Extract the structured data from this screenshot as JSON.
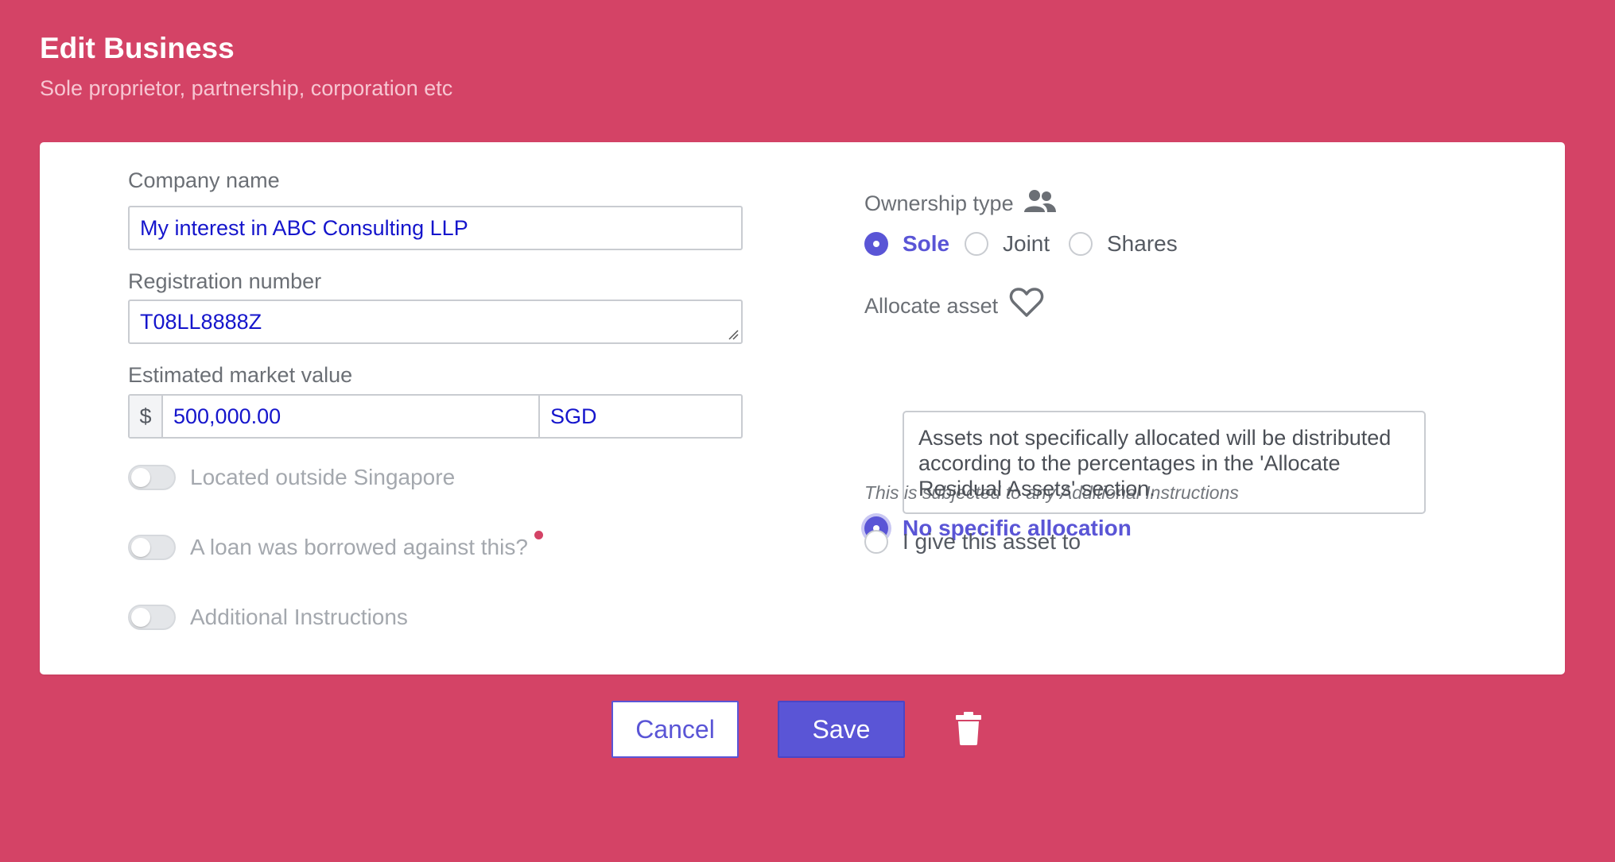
{
  "header": {
    "title": "Edit Business",
    "subtitle": "Sole proprietor, partnership, corporation etc"
  },
  "form": {
    "company_name": {
      "label": "Company name",
      "value": "My interest in ABC Consulting LLP"
    },
    "registration_number": {
      "label": "Registration number",
      "value": "T08LL8888Z"
    },
    "market_value": {
      "label": "Estimated market value",
      "prefix": "$",
      "amount": "500,000.00",
      "currency": "SGD"
    },
    "toggles": [
      {
        "label": "Located outside Singapore",
        "on": false
      },
      {
        "label": "A loan was borrowed against this?",
        "on": false
      },
      {
        "label": "Additional Instructions",
        "on": false
      }
    ]
  },
  "ownership": {
    "label": "Ownership type",
    "icon": "users-icon",
    "options": [
      "Sole",
      "Joint",
      "Shares"
    ],
    "selected": "Sole"
  },
  "allocate": {
    "label": "Allocate asset",
    "icon": "heart-icon",
    "note": "This is subjected to any Additional Instructions",
    "options": [
      "No specific allocation",
      "I give this asset to"
    ],
    "selected": "No specific allocation",
    "info": "Assets not specifically allocated will be distributed according to the percentages in the 'Allocate Residual Assets' section."
  },
  "actions": {
    "cancel": "Cancel",
    "save": "Save",
    "delete_icon": "trash-icon"
  },
  "colors": {
    "background": "#d44366",
    "accent": "#5a55d6",
    "input_text": "#1515cc"
  }
}
